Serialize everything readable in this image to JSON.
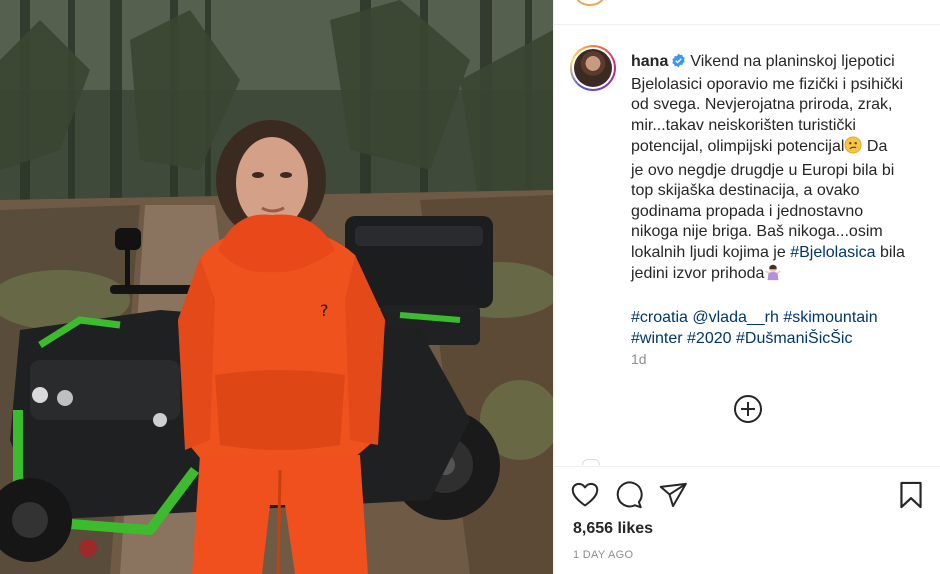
{
  "post": {
    "username": "hana",
    "caption_lines": [
      "Vikend na planinskoj ljepotici",
      "Bjelolasici oporavio me fizički i psihički",
      "od svega. Nevjerojatna priroda, zrak,",
      "mir...takav neiskorišten turistički",
      "potencijal, olimpijski potencijal",
      " Da",
      "je ovo negdje drugdje u Europi bila bi",
      "top skijaška destinacija, a ovako",
      "godinama propada i jednostavno",
      "nikoga nije briga. Baš nikoga...osim",
      "lokalnih ljudi kojima je ",
      "#Bjelolasica",
      " bila",
      "jedini izvor prihoda"
    ],
    "tags": {
      "t1": "#croatia",
      "t2": "@vlada__rh",
      "t3": "#skimountain",
      "t4": "#winter",
      "t5": "#2020",
      "t6": "#DušmaniŠicŠic"
    },
    "age": "1d",
    "likes": "8,656 likes",
    "time_ago": "1 DAY AGO"
  },
  "icons": {
    "verified": "verified-badge-icon",
    "confused_emoji": "confused-face-emoji",
    "shrug_emoji": "woman-shrugging-emoji",
    "load_more": "plus-circle-icon",
    "like": "heart-icon",
    "comment": "comment-bubble-icon",
    "share": "paper-plane-icon",
    "save": "bookmark-icon"
  },
  "colors": {
    "text": "#262626",
    "hashtag": "#00376b",
    "muted": "#8e8e8e",
    "verified": "#3897f0",
    "hoodie": "#f0521e",
    "atv_green": "#3dbb2f"
  }
}
